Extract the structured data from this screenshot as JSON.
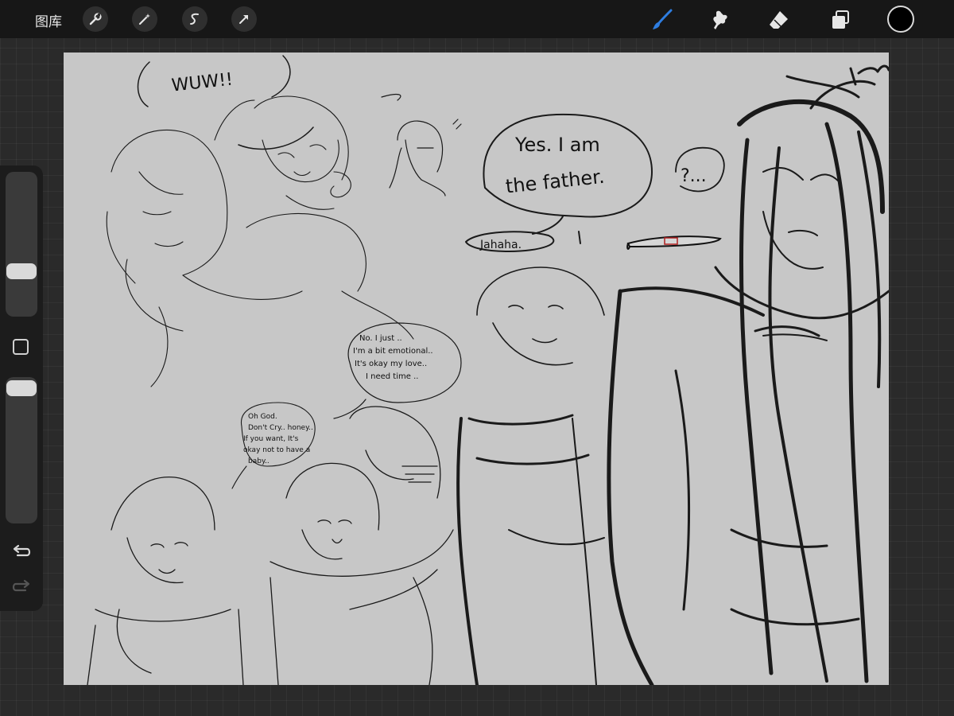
{
  "toolbar": {
    "gallery_label": "图库",
    "left_tools": [
      "wrench-icon",
      "magic-wand-icon",
      "selection-icon",
      "transform-arrow-icon"
    ],
    "right_tools": [
      "brush-icon",
      "smudge-icon",
      "eraser-icon",
      "layers-icon"
    ],
    "active_tool": "brush-icon",
    "accent_color": "#2e7de0",
    "current_color": "#000000"
  },
  "sidebar": {
    "brush_size_level": 0.72,
    "opacity_level": 0.04,
    "modify_button": "square-icon",
    "undo": "undo-icon",
    "redo": "redo-icon"
  },
  "canvas": {
    "background_color": "#c7c7c7",
    "texts": {
      "wow": "WUW!!",
      "bubble_main_line1": "Yes. I am",
      "bubble_main_line2": "the father.",
      "jahaha": "Jahaha.",
      "question": "?...",
      "bubble_mid_line1": "No. I just ..",
      "bubble_mid_line2": "I'm a bit emotional..",
      "bubble_mid_line3": "It's okay my love..",
      "bubble_mid_line4": "I need time ..",
      "bubble_small_line1": "Oh God.",
      "bubble_small_line2": "Don't Cry.. honey..",
      "bubble_small_line3": "If you want, It's",
      "bubble_small_line4": "okay not to have a",
      "bubble_small_line5": "baby.."
    }
  }
}
